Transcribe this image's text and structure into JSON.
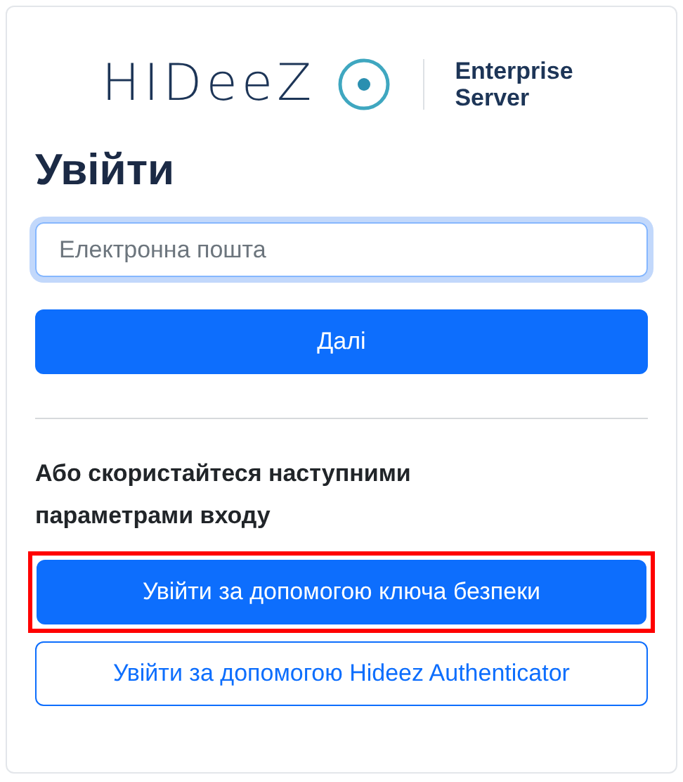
{
  "logo": {
    "wordmark": "HIDeeZ",
    "product": "Enterprise Server"
  },
  "title": "Увійти",
  "email": {
    "placeholder": "Електронна пошта",
    "focused": true
  },
  "next_button": "Далі",
  "alternatives_label": "Або скористайтеся наступними параметрами входу",
  "alternatives": [
    {
      "label": "Увійти за допомогою ключа безпеки",
      "kind": "primary",
      "highlighted": true
    },
    {
      "label": "Увійти за допомогою Hideez Authenticator",
      "kind": "outline",
      "highlighted": false
    }
  ]
}
